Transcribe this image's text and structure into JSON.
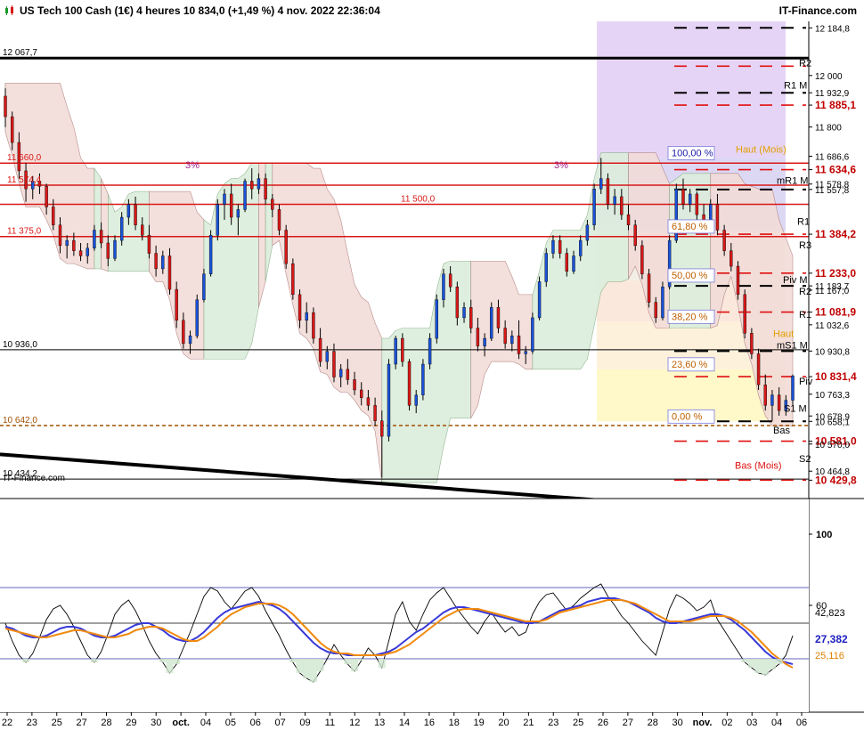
{
  "header": {
    "title": "US Tech 100 Cash (1€) 4 heures 10 834,0 (+1,49 %) 4 nov. 2022 22:36:04",
    "brand": "IT-Finance.com"
  },
  "chart_data": [
    {
      "type": "candlestick",
      "watermark": "IT-Finance.com",
      "ylim": [
        10400,
        12210
      ],
      "y_ticks": [
        "12 184,8",
        "12 000",
        "11 932,9",
        "11 885,1",
        "11 800",
        "11 686,6",
        "11 634,6",
        "11 578,8",
        "11 557,8",
        "11 384,2",
        "11 233,0",
        "11 183,7",
        "11 167,0",
        "11 081,9",
        "11 032,6",
        "10 930,8",
        "10 831,4",
        "10 763,3",
        "10 678,9",
        "10 658,1",
        "10 581,0",
        "10 570,0",
        "10 464,8",
        "10 429,8"
      ],
      "bold_ticks": [
        "11 885,1",
        "11 634,6",
        "11 384,2",
        "11 233,0",
        "11 081,9",
        "10 831,4",
        "10 581,0",
        "10 429,8"
      ],
      "x_labels": [
        "22",
        "23",
        "25",
        "27",
        "28",
        "29",
        "30",
        "oct.",
        "04",
        "05",
        "06",
        "07",
        "09",
        "11",
        "12",
        "13",
        "14",
        "16",
        "18",
        "19",
        "20",
        "21",
        "23",
        "25",
        "26",
        "27",
        "28",
        "30",
        "nov.",
        "02",
        "03",
        "04",
        "06"
      ],
      "horizontal_lines": [
        {
          "label": "12 067,7",
          "value": 12067.7,
          "color": "#000000"
        },
        {
          "label": "11 660,0",
          "value": 11660.0,
          "color": "#d81818"
        },
        {
          "label": "11 574,4",
          "value": 11574.4,
          "color": "#d81818"
        },
        {
          "label": "11 500,0",
          "value": 11500.0,
          "color": "#d81818"
        },
        {
          "label": "11 375,0",
          "value": 11375.0,
          "color": "#d81818"
        },
        {
          "label": "10 936,0",
          "value": 10936.0,
          "color": "#000000"
        },
        {
          "label": "10 642,0",
          "value": 10642.0,
          "color": "#a05000"
        },
        {
          "label": "10 434,2",
          "value": 10434.2,
          "color": "#000000"
        }
      ],
      "fibonacci": [
        {
          "label": "100,00 %",
          "value": 11680
        },
        {
          "label": "61,80 %",
          "value": 11395
        },
        {
          "label": "50,00 %",
          "value": 11205
        },
        {
          "label": "38,20 %",
          "value": 11045
        },
        {
          "label": "23,60 %",
          "value": 10860
        },
        {
          "label": "0,00 %",
          "value": 10658
        }
      ],
      "pivot_labels": [
        "R2",
        "R1 M",
        "Haut (Mois)",
        "mR1 M",
        "R1",
        "R3",
        "Piv M",
        "R2",
        "R1",
        "Haut",
        "mS1 M",
        "Piv",
        "S1 M",
        "Bas",
        "S2",
        "Bas (Mois)"
      ],
      "annotations": [
        "3%",
        "3%"
      ],
      "candles": [
        [
          11920,
          11950,
          11800,
          11840
        ],
        [
          11840,
          11860,
          11710,
          11740
        ],
        [
          11740,
          11780,
          11600,
          11630
        ],
        [
          11630,
          11660,
          11510,
          11560
        ],
        [
          11560,
          11610,
          11520,
          11590
        ],
        [
          11590,
          11620,
          11540,
          11570
        ],
        [
          11570,
          11580,
          11460,
          11490
        ],
        [
          11490,
          11520,
          11400,
          11420
        ],
        [
          11420,
          11450,
          11310,
          11340
        ],
        [
          11340,
          11380,
          11290,
          11360
        ],
        [
          11360,
          11390,
          11300,
          11320
        ],
        [
          11320,
          11350,
          11280,
          11300
        ],
        [
          11300,
          11350,
          11270,
          11330
        ],
        [
          11330,
          11420,
          11320,
          11400
        ],
        [
          11400,
          11430,
          11330,
          11350
        ],
        [
          11350,
          11380,
          11260,
          11290
        ],
        [
          11290,
          11380,
          11280,
          11360
        ],
        [
          11360,
          11470,
          11340,
          11450
        ],
        [
          11450,
          11520,
          11420,
          11500
        ],
        [
          11500,
          11530,
          11400,
          11420
        ],
        [
          11420,
          11450,
          11360,
          11380
        ],
        [
          11380,
          11420,
          11290,
          11310
        ],
        [
          11310,
          11340,
          11220,
          11250
        ],
        [
          11250,
          11320,
          11230,
          11300
        ],
        [
          11300,
          11330,
          11150,
          11170
        ],
        [
          11170,
          11200,
          11020,
          11050
        ],
        [
          11050,
          11080,
          10940,
          10960
        ],
        [
          10960,
          11010,
          10920,
          10990
        ],
        [
          10990,
          11150,
          10980,
          11130
        ],
        [
          11130,
          11250,
          11120,
          11230
        ],
        [
          11230,
          11400,
          11220,
          11380
        ],
        [
          11380,
          11520,
          11360,
          11500
        ],
        [
          11500,
          11560,
          11440,
          11540
        ],
        [
          11540,
          11580,
          11420,
          11450
        ],
        [
          11450,
          11500,
          11380,
          11480
        ],
        [
          11480,
          11600,
          11470,
          11590
        ],
        [
          11590,
          11640,
          11520,
          11560
        ],
        [
          11560,
          11620,
          11540,
          11600
        ],
        [
          11600,
          11620,
          11500,
          11520
        ],
        [
          11520,
          11540,
          11450,
          11480
        ],
        [
          11480,
          11500,
          11380,
          11400
        ],
        [
          11400,
          11420,
          11250,
          11270
        ],
        [
          11270,
          11290,
          11130,
          11150
        ],
        [
          11150,
          11170,
          11020,
          11050
        ],
        [
          11050,
          11120,
          11000,
          11080
        ],
        [
          11080,
          11100,
          10960,
          10980
        ],
        [
          10980,
          11020,
          10870,
          10890
        ],
        [
          10890,
          10950,
          10860,
          10930
        ],
        [
          10930,
          10960,
          10810,
          10830
        ],
        [
          10830,
          10880,
          10790,
          10860
        ],
        [
          10860,
          10900,
          10800,
          10820
        ],
        [
          10820,
          10850,
          10760,
          10780
        ],
        [
          10780,
          10810,
          10720,
          10750
        ],
        [
          10750,
          10780,
          10700,
          10720
        ],
        [
          10720,
          10750,
          10640,
          10660
        ],
        [
          10660,
          10700,
          10440,
          10600
        ],
        [
          10600,
          10900,
          10580,
          10880
        ],
        [
          10880,
          10990,
          10860,
          10980
        ],
        [
          10980,
          11000,
          10870,
          10890
        ],
        [
          10890,
          10900,
          10700,
          10720
        ],
        [
          10720,
          10780,
          10690,
          10760
        ],
        [
          10760,
          10900,
          10740,
          10880
        ],
        [
          10880,
          11000,
          10860,
          10980
        ],
        [
          10980,
          11150,
          10960,
          11130
        ],
        [
          11130,
          11250,
          11100,
          11230
        ],
        [
          11230,
          11260,
          11160,
          11180
        ],
        [
          11180,
          11200,
          11030,
          11060
        ],
        [
          11060,
          11120,
          11040,
          11100
        ],
        [
          11100,
          11130,
          11000,
          11020
        ],
        [
          11020,
          11060,
          10930,
          10950
        ],
        [
          10950,
          11000,
          10910,
          10980
        ],
        [
          10980,
          11120,
          10970,
          11100
        ],
        [
          11100,
          11130,
          11000,
          11020
        ],
        [
          11020,
          11050,
          10940,
          10960
        ],
        [
          10960,
          11010,
          10930,
          10990
        ],
        [
          10990,
          11050,
          10900,
          10920
        ],
        [
          10920,
          10950,
          10880,
          10930
        ],
        [
          10930,
          11080,
          10920,
          11060
        ],
        [
          11060,
          11220,
          11050,
          11200
        ],
        [
          11200,
          11330,
          11180,
          11310
        ],
        [
          11310,
          11380,
          11290,
          11360
        ],
        [
          11360,
          11380,
          11290,
          11310
        ],
        [
          11310,
          11330,
          11220,
          11240
        ],
        [
          11240,
          11320,
          11230,
          11300
        ],
        [
          11300,
          11380,
          11280,
          11360
        ],
        [
          11360,
          11440,
          11340,
          11420
        ],
        [
          11420,
          11580,
          11400,
          11560
        ],
        [
          11560,
          11680,
          11540,
          11600
        ],
        [
          11600,
          11620,
          11480,
          11500
        ],
        [
          11500,
          11560,
          11460,
          11530
        ],
        [
          11530,
          11560,
          11440,
          11460
        ],
        [
          11460,
          11500,
          11400,
          11420
        ],
        [
          11420,
          11440,
          11320,
          11340
        ],
        [
          11340,
          11360,
          11210,
          11230
        ],
        [
          11230,
          11250,
          11100,
          11120
        ],
        [
          11120,
          11140,
          11040,
          11060
        ],
        [
          11060,
          11200,
          11050,
          11180
        ],
        [
          11180,
          11380,
          11170,
          11360
        ],
        [
          11360,
          11580,
          11350,
          11560
        ],
        [
          11560,
          11600,
          11480,
          11500
        ],
        [
          11500,
          11560,
          11470,
          11540
        ],
        [
          11540,
          11550,
          11440,
          11460
        ],
        [
          11460,
          11500,
          11420,
          11440
        ],
        [
          11440,
          11520,
          11430,
          11500
        ],
        [
          11500,
          11540,
          11380,
          11400
        ],
        [
          11400,
          11420,
          11300,
          11320
        ],
        [
          11320,
          11350,
          11240,
          11260
        ],
        [
          11260,
          11280,
          11130,
          11150
        ],
        [
          11150,
          11170,
          10980,
          11000
        ],
        [
          11000,
          11020,
          10900,
          10920
        ],
        [
          10920,
          10940,
          10780,
          10800
        ],
        [
          10800,
          10840,
          10700,
          10720
        ],
        [
          10720,
          10780,
          10660,
          10760
        ],
        [
          10760,
          10790,
          10680,
          10700
        ],
        [
          10700,
          10760,
          10680,
          10740
        ],
        [
          10740,
          10840,
          10720,
          10834
        ]
      ]
    },
    {
      "type": "line",
      "ylim": [
        0,
        120
      ],
      "y_ticks": [
        "100",
        "60"
      ],
      "levels": [
        70,
        50,
        30
      ],
      "last_values": [
        "42,823",
        "27,382",
        "25,116"
      ],
      "series": [
        {
          "values": [
            50,
            40,
            32,
            28,
            33,
            42,
            52,
            58,
            60,
            55,
            48,
            40,
            32,
            28,
            34,
            44,
            55,
            60,
            63,
            57,
            49,
            40,
            33,
            28,
            22,
            27,
            36,
            45,
            55,
            65,
            70,
            68,
            62,
            58,
            63,
            68,
            70,
            65,
            57,
            50,
            43,
            35,
            28,
            22,
            19,
            17,
            23,
            30,
            38,
            32,
            27,
            23,
            29,
            36,
            32,
            25,
            40,
            55,
            62,
            51,
            46,
            55,
            63,
            67,
            70,
            64,
            58,
            53,
            48,
            44,
            51,
            56,
            50,
            45,
            48,
            43,
            45,
            55,
            62,
            66,
            67,
            62,
            57,
            60,
            64,
            67,
            70,
            72,
            65,
            60,
            54,
            50,
            45,
            40,
            36,
            32,
            45,
            58,
            66,
            64,
            61,
            57,
            59,
            63,
            52,
            46,
            40,
            34,
            28,
            25,
            22,
            21,
            24,
            27,
            32,
            43
          ]
        },
        {
          "values": [
            48,
            47,
            45,
            43,
            42,
            42,
            43,
            45,
            47,
            48,
            48,
            47,
            45,
            43,
            42,
            42,
            43,
            45,
            47,
            49,
            50,
            50,
            48,
            46,
            43,
            41,
            40,
            40,
            42,
            45,
            49,
            53,
            56,
            58,
            59,
            60,
            61,
            62,
            61,
            60,
            58,
            55,
            51,
            47,
            43,
            39,
            36,
            34,
            33,
            33,
            32,
            32,
            32,
            32,
            32,
            33,
            34,
            36,
            39,
            42,
            45,
            47,
            50,
            53,
            56,
            58,
            59,
            59,
            58,
            57,
            56,
            55,
            54,
            53,
            52,
            51,
            50,
            50,
            51,
            53,
            55,
            57,
            58,
            59,
            60,
            62,
            63,
            64,
            64,
            64,
            63,
            62,
            60,
            58,
            56,
            53,
            51,
            50,
            50,
            51,
            52,
            53,
            54,
            55,
            55,
            54,
            52,
            49,
            46,
            42,
            38,
            34,
            31,
            29,
            28,
            27
          ]
        },
        {
          "values": [
            47,
            46,
            45,
            44,
            43,
            42,
            42,
            43,
            44,
            45,
            46,
            46,
            45,
            44,
            43,
            42,
            42,
            43,
            44,
            46,
            47,
            48,
            48,
            47,
            45,
            43,
            41,
            40,
            40,
            42,
            45,
            48,
            52,
            55,
            57,
            59,
            60,
            61,
            61,
            61,
            60,
            58,
            55,
            51,
            47,
            43,
            39,
            36,
            34,
            33,
            33,
            32,
            32,
            32,
            32,
            32,
            33,
            34,
            36,
            38,
            41,
            44,
            47,
            50,
            53,
            55,
            57,
            58,
            58,
            58,
            57,
            56,
            55,
            54,
            53,
            52,
            51,
            51,
            51,
            52,
            54,
            56,
            57,
            58,
            59,
            60,
            61,
            62,
            63,
            63,
            63,
            62,
            61,
            59,
            57,
            55,
            53,
            51,
            51,
            51,
            51,
            52,
            53,
            54,
            54,
            54,
            53,
            51,
            48,
            45,
            41,
            37,
            33,
            30,
            27,
            25
          ]
        }
      ]
    }
  ],
  "colors": {
    "bull": "#1a52d8",
    "bear": "#d81818",
    "resistance": "#e01010",
    "fib_bg": "#fff8c8",
    "cloud_red": "#f2dcd8",
    "cloud_green": "#dceedc",
    "purple_zone": "#e6d4f6",
    "oscillator": "#000000",
    "signal1": "#3a3ad8",
    "signal2": "#f08a10"
  }
}
